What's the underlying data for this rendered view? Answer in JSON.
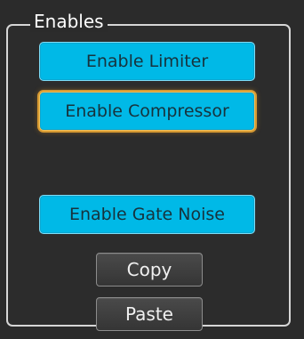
{
  "panel": {
    "title": "Enables"
  },
  "buttons": {
    "enable_limiter": "Enable Limiter",
    "enable_compressor": "Enable Compressor",
    "enable_gate_noise": "Enable Gate Noise",
    "copy": "Copy",
    "paste": "Paste"
  },
  "colors": {
    "primary_button": "#00b9e7",
    "focus_outline": "#d79a32",
    "panel_border": "#d6d6d6",
    "background": "#2b2b2b"
  }
}
